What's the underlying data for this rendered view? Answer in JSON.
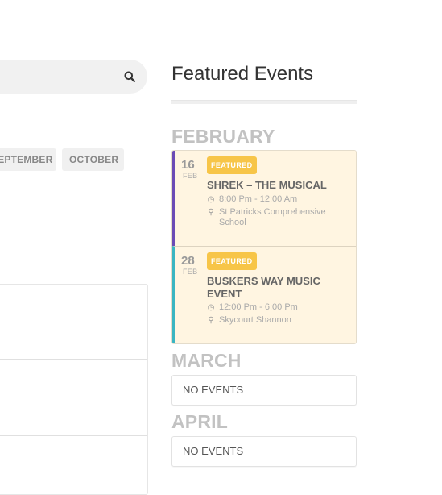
{
  "search": {
    "icon": "search-icon"
  },
  "months_nav": {
    "september_label": "SEPTEMBER",
    "october_label": "OCTOBER"
  },
  "sidebar": {
    "title": "Featured Events",
    "months": [
      {
        "name": "FEBRUARY",
        "events": [
          {
            "day": "16",
            "month": "FEB",
            "badge": "FEATURED",
            "title": "SHREK – THE MUSICAL",
            "time": "8:00 Pm - 12:00 Am",
            "location": "St Patricks Comprehensive School",
            "accent": "#6b4bb5"
          },
          {
            "day": "28",
            "month": "FEB",
            "badge": "FEATURED",
            "title": "BUSKERS WAY MUSIC EVENT",
            "time": "12:00 Pm - 6:00 Pm",
            "location": "Skycourt Shannon",
            "accent": "#3ab5c2"
          }
        ]
      },
      {
        "name": "MARCH",
        "empty_label": "NO EVENTS"
      },
      {
        "name": "APRIL",
        "empty_label": "NO EVENTS"
      }
    ]
  },
  "colors": {
    "event_bg": "#fff5e1",
    "badge": "#f7c548",
    "month_heading": "#c2c2c2"
  }
}
